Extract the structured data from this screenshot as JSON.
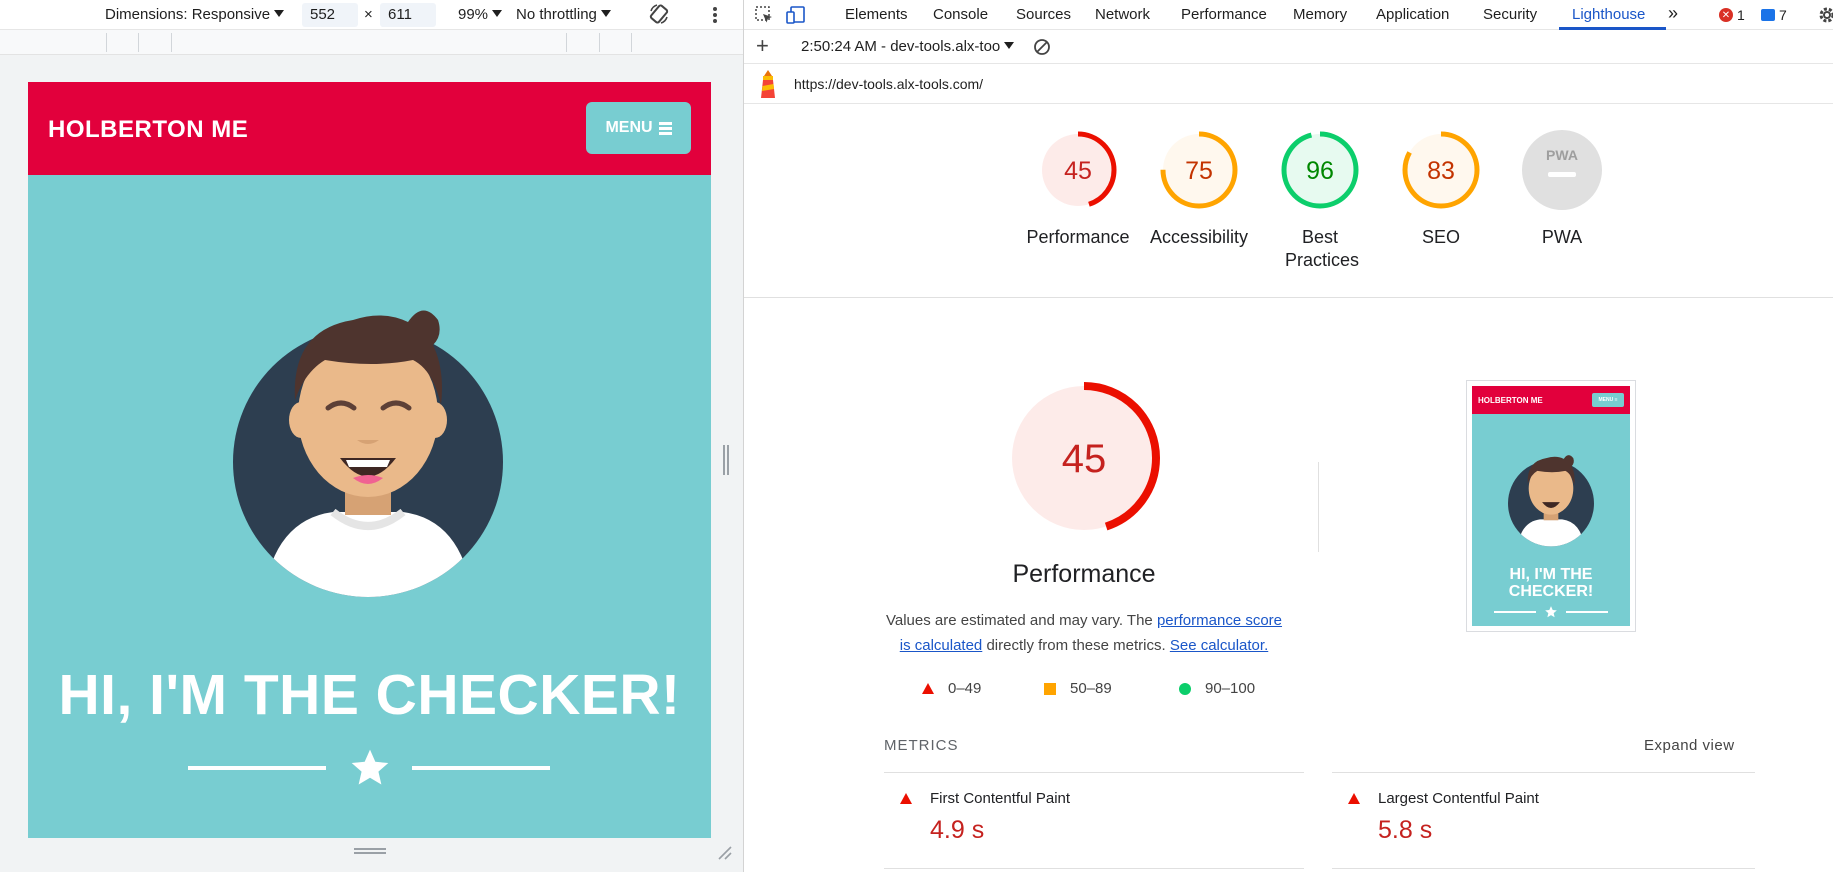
{
  "device_toolbar": {
    "dimensions_label": "Dimensions: Responsive",
    "width": "552",
    "times": "×",
    "height": "611",
    "zoom": "99%",
    "throttling": "No throttling"
  },
  "site": {
    "title": "HOLBERTON ME",
    "menu_label": "MENU",
    "hero_title": "HI, I'M THE CHECKER!"
  },
  "devtools": {
    "tabs": [
      "Elements",
      "Console",
      "Sources",
      "Network",
      "Performance",
      "Memory",
      "Application",
      "Security",
      "Lighthouse"
    ],
    "active_tab": "Lighthouse",
    "overflow_label": "»",
    "error_count": "1",
    "message_count": "7",
    "report_selector": "2:50:24 AM - dev-tools.alx-too",
    "url": "https://dev-tools.alx-tools.com/"
  },
  "scores": [
    {
      "label": "Performance",
      "value": "45",
      "score": 45,
      "status": "fail"
    },
    {
      "label": "Accessibility",
      "value": "75",
      "score": 75,
      "status": "average"
    },
    {
      "label": "Best Practices",
      "value": "96",
      "score": 96,
      "status": "pass"
    },
    {
      "label": "SEO",
      "value": "83",
      "score": 83,
      "status": "average"
    },
    {
      "label": "PWA",
      "value": "PWA",
      "score": null,
      "status": "na"
    }
  ],
  "performance": {
    "score": "45",
    "score_num": 45,
    "title": "Performance",
    "desc_prefix": "Values are estimated and may vary. The",
    "desc_link": "performance score is calculated",
    "desc_mid": "directly from these metrics.",
    "desc_calc": "See calculator.",
    "legend": [
      {
        "range": "0–49",
        "shape": "triangle",
        "color": "#eb0f00"
      },
      {
        "range": "50–89",
        "shape": "square",
        "color": "#ffa400"
      },
      {
        "range": "90–100",
        "shape": "circle",
        "color": "#0cce6b"
      }
    ]
  },
  "screenshot": {
    "title": "HOLBERTON ME",
    "menu": "MENU ≡",
    "hero": "HI, I'M THE CHECKER!"
  },
  "metrics": {
    "heading": "METRICS",
    "expand_label": "Expand view",
    "items": [
      {
        "name": "First Contentful Paint",
        "value": "4.9 s"
      },
      {
        "name": "Largest Contentful Paint",
        "value": "5.8 s"
      }
    ]
  },
  "colors": {
    "fail": "#eb0f00",
    "fail_text": "#c5221f",
    "fail_bg": "#fdebe9",
    "average": "#ffa400",
    "average_text": "#c33300",
    "average_bg": "#fff8ee",
    "pass": "#0cce6b",
    "pass_text": "#008800",
    "pass_bg": "#e7faf0",
    "na": "#bdbdbd",
    "na_bg": "#e0e0e0",
    "accent": "#1a56c8",
    "brand_red": "#e2003c",
    "brand_teal": "#78cdd1"
  }
}
